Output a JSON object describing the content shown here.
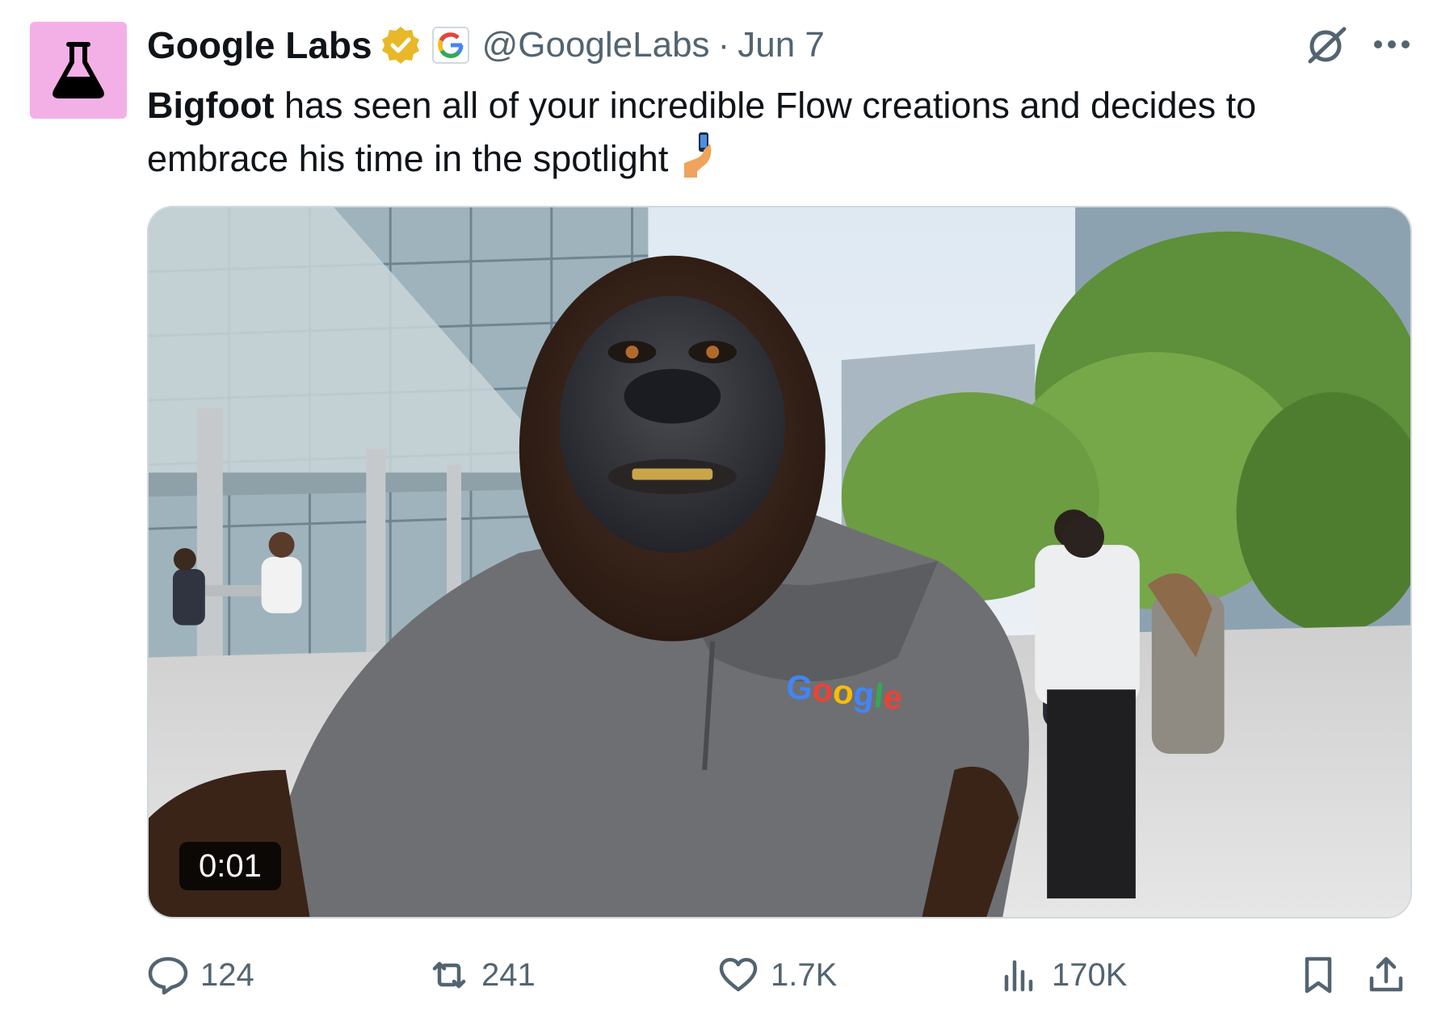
{
  "tweet": {
    "author_name": "Google Labs",
    "handle": "@GoogleLabs",
    "separator": "·",
    "date": "Jun 7",
    "text_bold": "Bigfoot",
    "text_line1": " has seen all of your incredible Flow creations and decides to",
    "text_line2": "embrace his time in the spotlight"
  },
  "media": {
    "type": "video",
    "timestamp": "0:01",
    "shirt_logo_text": "Google"
  },
  "metrics": {
    "replies": "124",
    "reposts": "241",
    "likes": "1.7K",
    "views": "170K"
  },
  "icons": {
    "avatar": "flask-icon",
    "verified": "verified-badge-icon",
    "affiliate": "google-g-icon",
    "grok": "grok-icon",
    "more": "more-icon",
    "reply": "reply-icon",
    "repost": "repost-icon",
    "like": "heart-icon",
    "views": "views-icon",
    "bookmark": "bookmark-icon",
    "share": "share-icon",
    "emoji": "selfie-emoji"
  },
  "colors": {
    "avatar_bg": "#f3b0e6",
    "verified": "#e8b829",
    "text": "#0f1419",
    "secondary": "#536471"
  }
}
